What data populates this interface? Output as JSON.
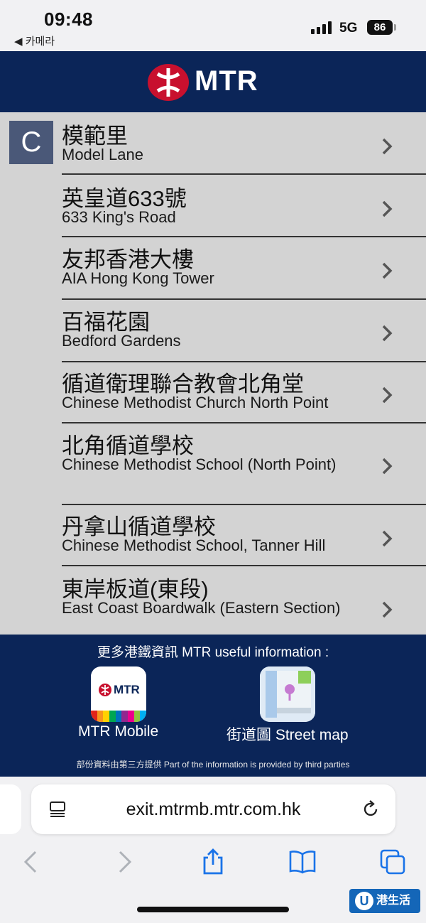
{
  "status_bar": {
    "time": "09:48",
    "back_app": "◀ 카메라",
    "network": "5G",
    "battery": "86"
  },
  "header": {
    "logo_text": "MTR"
  },
  "section_letter": "C",
  "list_items": [
    {
      "zh": "模範里",
      "en": "Model Lane"
    },
    {
      "zh": "英皇道633號",
      "en": "633 King's Road"
    },
    {
      "zh": "友邦香港大樓",
      "en": "AIA Hong Kong Tower"
    },
    {
      "zh": "百福花園",
      "en": "Bedford Gardens"
    },
    {
      "zh": "循道衛理聯合教會北角堂",
      "en": "Chinese Methodist Church North Point"
    },
    {
      "zh": "北角循道學校",
      "en": "Chinese Methodist School (North Point)"
    },
    {
      "zh": "丹拿山循道學校",
      "en": "Chinese Methodist School, Tanner Hill"
    },
    {
      "zh": "東岸板道(東段)",
      "en": "East Coast Boardwalk (Eastern Section)"
    }
  ],
  "info_panel": {
    "title": "更多港鐵資訊  MTR useful information :",
    "app_mtr_logo": "MTR",
    "app_mtr_label": "MTR Mobile",
    "app_map_label": "街道圖  Street map",
    "footer": "部份資料由第三方提供 Part of the information is provided by third parties"
  },
  "browser": {
    "url": "exit.mtrmb.mtr.com.hk"
  },
  "watermark": {
    "u": "U",
    "text": "港生活"
  },
  "icons": [
    "reader-icon",
    "reload-icon",
    "back-icon",
    "forward-icon",
    "share-icon",
    "bookmarks-icon",
    "tabs-icon",
    "chevron-right-icon"
  ],
  "colors": {
    "header_bg": "#0b2558",
    "list_bg": "#d3d3d3",
    "letter_bg": "#4a5878",
    "mtr_red": "#c8102e"
  }
}
